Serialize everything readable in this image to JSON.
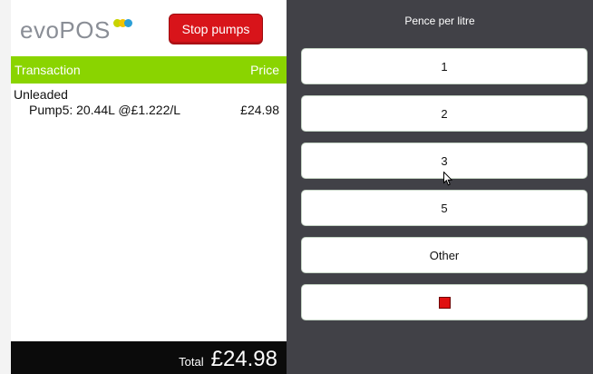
{
  "header": {
    "logo_text": "evoPOS",
    "stop_label": "Stop pumps"
  },
  "transaction": {
    "col_transaction": "Transaction",
    "col_price": "Price",
    "items": [
      {
        "name": "Unleaded",
        "detail": "Pump5: 20.44L @£1.222/L",
        "price": "£24.98"
      }
    ],
    "total_label": "Total",
    "total_value": "£24.98"
  },
  "options": {
    "title": "Pence per litre",
    "buttons": [
      "1",
      "2",
      "3",
      "5",
      "Other"
    ],
    "stop_icon": "stop-square-icon"
  },
  "colors": {
    "accent_green": "#8ad400",
    "stop_red": "#d8141a",
    "panel_dark": "#414147",
    "logo_green": "#c8d400",
    "logo_yellow": "#f2c400",
    "logo_blue": "#2c9fd6"
  }
}
